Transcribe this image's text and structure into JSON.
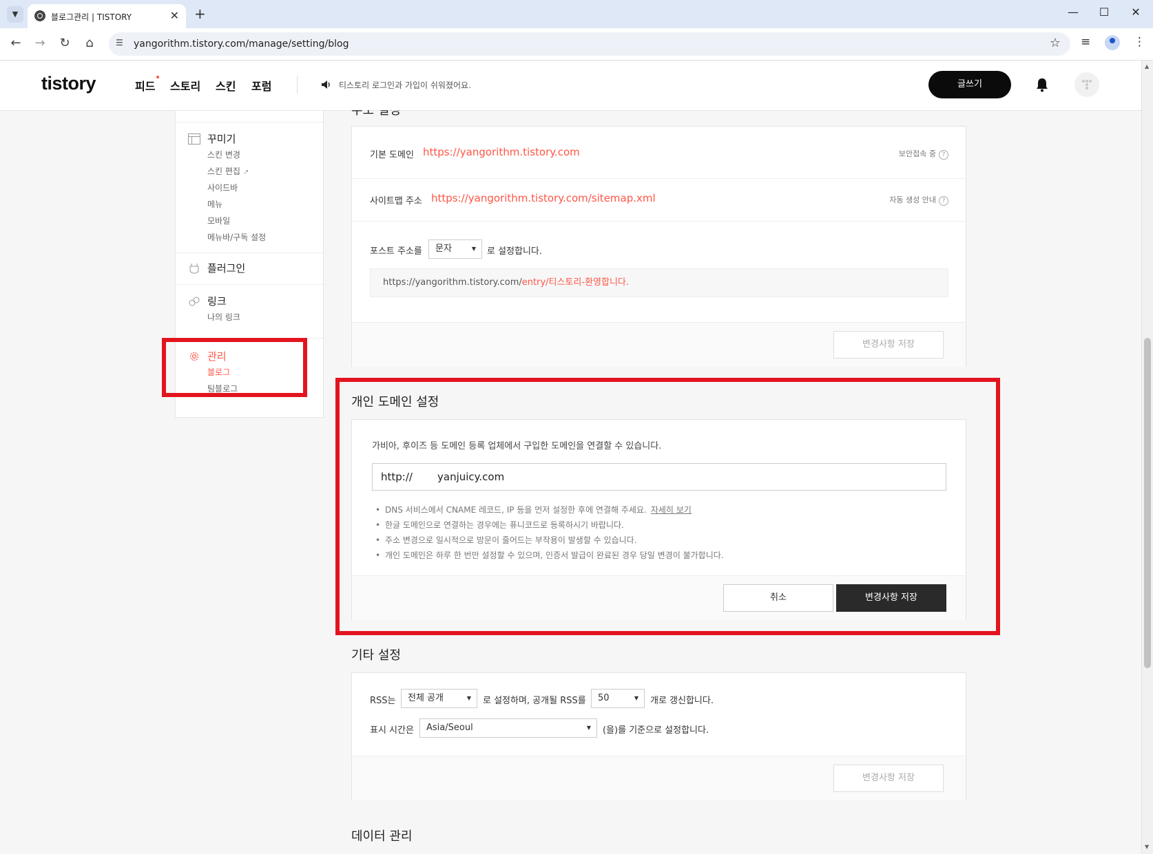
{
  "browser": {
    "tab_title": "블로그관리 | TISTORY",
    "url": "yangorithm.tistory.com/manage/setting/blog"
  },
  "header": {
    "logo": "tistory",
    "nav": [
      "피드",
      "스토리",
      "스킨",
      "포럼"
    ],
    "notice": "티스토리 로그인과 가입이 쉬워졌어요.",
    "write_button": "글쓰기"
  },
  "sidebar": {
    "decorate": {
      "label": "꾸미기",
      "items": [
        "스킨 변경",
        "스킨 편집",
        "사이드바",
        "메뉴",
        "모바일",
        "메뉴바/구독 설정"
      ]
    },
    "plugin": {
      "label": "플러그인"
    },
    "link": {
      "label": "링크",
      "items": [
        "나의 링크"
      ]
    },
    "manage": {
      "label": "관리",
      "items": [
        "블로그",
        "팀블로그"
      ]
    }
  },
  "address_section": {
    "title": "주소 설정",
    "default_domain_label": "기본 도메인",
    "default_domain": "https://yangorithm.tistory.com",
    "secure_help": "보안접속 중",
    "sitemap_label": "사이트맵 주소",
    "sitemap_url": "https://yangorithm.tistory.com/sitemap.xml",
    "sitemap_help": "자동 생성 안내",
    "post_address_prefix": "포스트 주소를",
    "post_address_option": "문자",
    "post_address_suffix": "로 설정합니다.",
    "preview_base": "https://yangorithm.tistory.com/",
    "preview_path": "entry/티스토리-환영합니다.",
    "save_button": "변경사항 저장"
  },
  "custom_domain_section": {
    "title": "개인 도메인 설정",
    "description": "가비아, 후이즈 등 도메인 등록 업체에서 구입한 도메인을 연결할 수 있습니다.",
    "prefix": "http://",
    "value": "yanjuicy.com",
    "notes": [
      "DNS 서비스에서 CNAME 레코드, IP 등을 먼저 설정한 후에 연결해 주세요.",
      "한글 도메인으로 연결하는 경우에는 퓨니코드로 등록하시기 바랍니다.",
      "주소 변경으로 일시적으로 방문이 줄어드는 부작용이 발생할 수 있습니다.",
      "개인 도메인은 하루 한 번만 설정할 수 있으며, 인증서 발급이 완료된 경우 당일 변경이 불가합니다."
    ],
    "note_link": "자세히 보기",
    "cancel_button": "취소",
    "save_button": "변경사항 저장"
  },
  "etc_section": {
    "title": "기타 설정",
    "rss_prefix": "RSS는",
    "rss_option": "전체 공개",
    "rss_middle": "로 설정하며, 공개될 RSS를",
    "rss_count": "50",
    "rss_suffix": "개로 갱신합니다.",
    "time_prefix": "표시 시간은",
    "timezone": "Asia/Seoul",
    "time_suffix": "(을)를 기준으로 설정합니다.",
    "save_button": "변경사항 저장"
  },
  "data_section": {
    "title": "데이터 관리"
  },
  "colors": {
    "accent": "#ff5544",
    "highlight": "#e3141f",
    "dark_button": "#2a2a2a"
  }
}
